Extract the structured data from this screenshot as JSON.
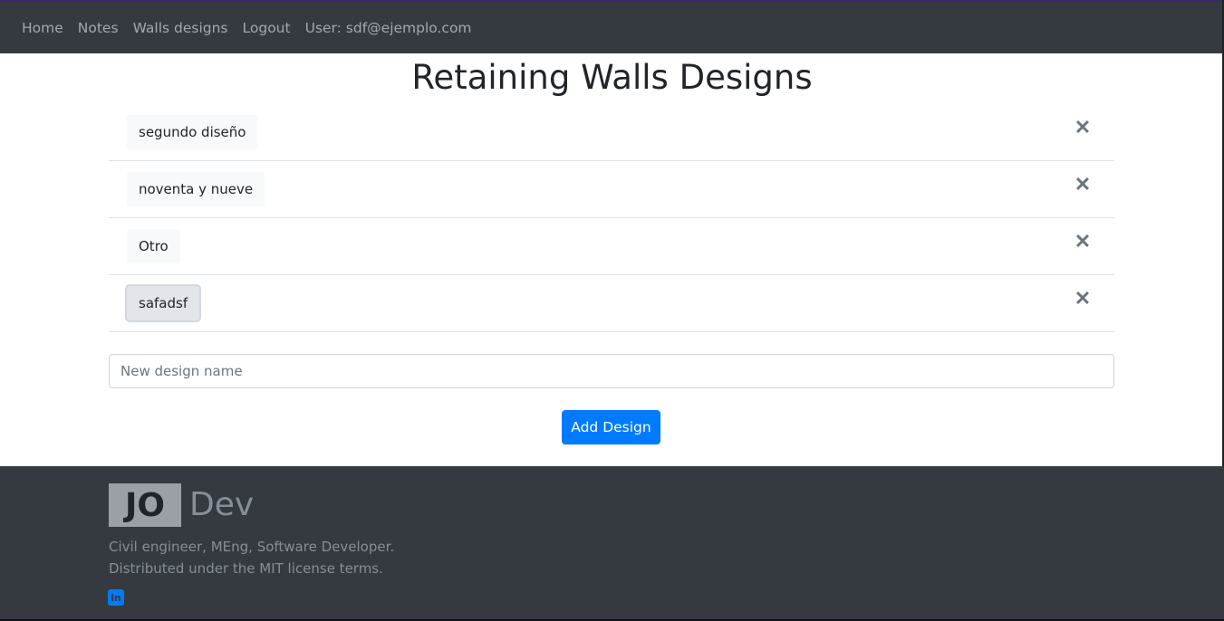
{
  "nav": {
    "items": [
      "Home",
      "Notes",
      "Walls designs",
      "Logout"
    ],
    "user": "User: sdf@ejemplo.com"
  },
  "page": {
    "title": "Retaining Walls Designs"
  },
  "designs": [
    {
      "name": "segundo diseño",
      "active": false
    },
    {
      "name": "noventa y nueve",
      "active": false
    },
    {
      "name": "Otro",
      "active": false
    },
    {
      "name": "safadsf",
      "active": true
    }
  ],
  "delete_symbol": "✕",
  "new_design": {
    "placeholder": "New design name",
    "value": ""
  },
  "add_button": "Add Design",
  "footer": {
    "logo_initials": "JO",
    "logo_text": "Dev",
    "line1": "Civil engineer, MEng, Software Developer.",
    "line2": "Distributed under the MIT license terms.",
    "social_icon": "linkedin-icon",
    "social_glyph": "in"
  },
  "colors": {
    "navbar": "#343a40",
    "primary": "#007bff",
    "footer": "#343a40"
  }
}
